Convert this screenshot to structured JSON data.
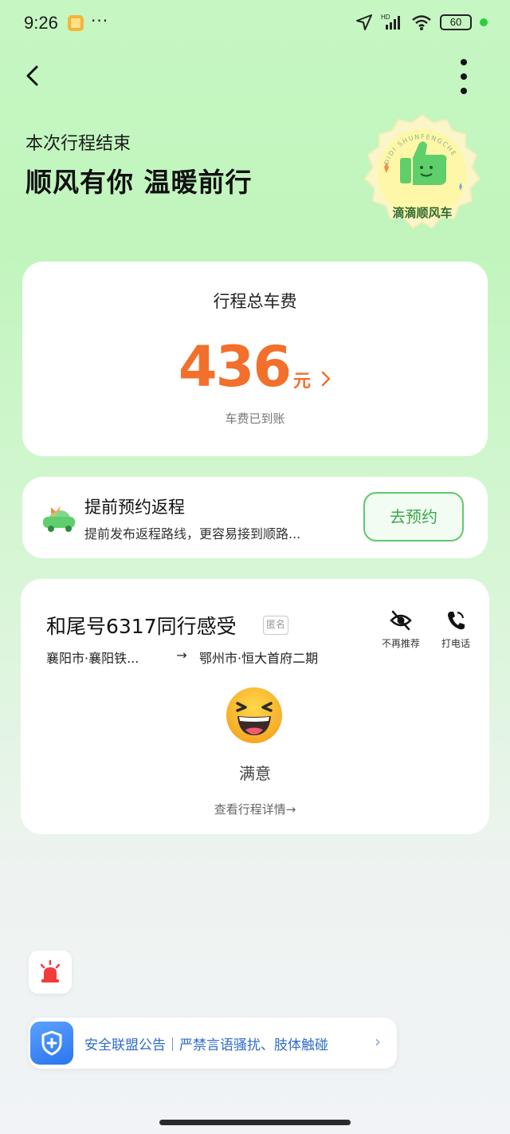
{
  "status_bar": {
    "time": "9:26",
    "dots": "···",
    "network": "HD",
    "battery": "60"
  },
  "header": {
    "trip_end": "本次行程结束",
    "headline": "顺风有你 温暖前行",
    "badge": {
      "arc_text": "DIDI SHUNFENGCHE",
      "name": "滴滴顺风车"
    }
  },
  "fare_card": {
    "title": "行程总车费",
    "amount": "436",
    "unit": "元",
    "status": "车费已到账"
  },
  "return_card": {
    "title": "提前预约返程",
    "description": "提前发布返程路线，更容易接到顺路...",
    "button": "去预约"
  },
  "rating_card": {
    "title": "和尾号6317同行感受",
    "anon_tag": "匿名",
    "route_from": "襄阳市·襄阳铁...",
    "route_arrow": "→",
    "route_to": "鄂州市·恒大首府二期",
    "hide_label": "不再推荐",
    "call_label": "打电话",
    "rating": "满意",
    "view_detail": "查看行程详情→"
  },
  "safety_bar": {
    "text": "安全联盟公告｜严禁言语骚扰、肢体触碰",
    "arrow": "›"
  },
  "colors": {
    "accent_orange": "#f2702b",
    "brand_green": "#5dc96c",
    "safety_blue": "#2f6cc9"
  }
}
